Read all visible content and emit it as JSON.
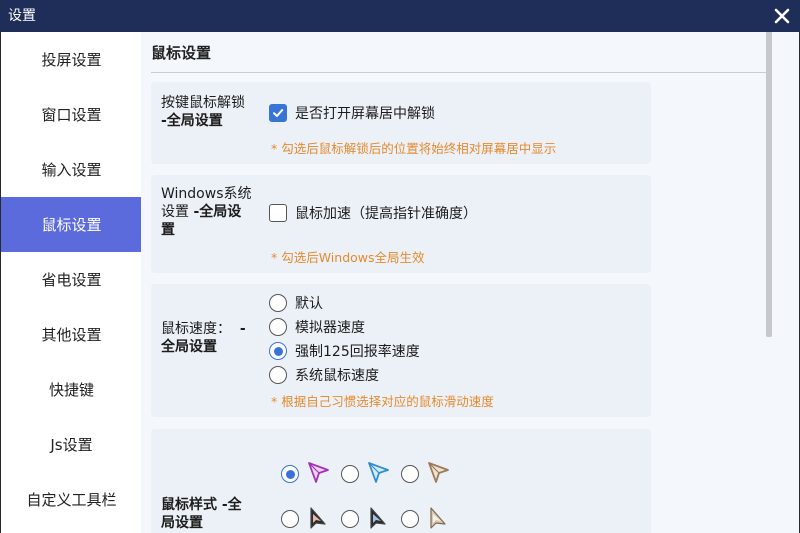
{
  "window": {
    "title": "设置"
  },
  "sidebar": {
    "items": [
      {
        "label": "投屏设置",
        "active": false
      },
      {
        "label": "窗口设置",
        "active": false
      },
      {
        "label": "输入设置",
        "active": false
      },
      {
        "label": "鼠标设置",
        "active": true
      },
      {
        "label": "省电设置",
        "active": false
      },
      {
        "label": "其他设置",
        "active": false
      },
      {
        "label": "快捷键",
        "active": false
      },
      {
        "label": "Js设置",
        "active": false
      },
      {
        "label": "自定义工具栏",
        "active": false
      }
    ]
  },
  "main": {
    "title": "鼠标设置",
    "unlock": {
      "label": "按键鼠标解锁",
      "scope": "-全局设置",
      "checkbox_label": "是否打开屏幕居中解锁",
      "checked": true,
      "note": "* 勾选后鼠标解锁后的位置将始终相对屏幕居中显示"
    },
    "windows": {
      "label": "Windows系统设置",
      "label_line1": "Windows系统",
      "label_line2a": "设置 ",
      "scope_line2": "-全局设",
      "scope_line3": "置",
      "checkbox_label": "鼠标加速（提高指针准确度）",
      "checked": false,
      "note": "* 勾选后Windows全局生效"
    },
    "speed": {
      "label": "鼠标速度：",
      "scope_line1": "-",
      "scope_line2": "全局设置",
      "options": [
        "默认",
        "模拟器速度",
        "强制125回报率速度",
        "系统鼠标速度"
      ],
      "selected": 2,
      "note": "* 根据自己习惯选择对应的鼠标滑动速度"
    },
    "style": {
      "label": "鼠标样式",
      "scope_line1": " -全",
      "scope_line2": "局设置",
      "options": [
        {
          "icon": "arrow-cursor-purple-icon"
        },
        {
          "icon": "arrow-cursor-blue-icon"
        },
        {
          "icon": "arrow-cursor-tan-icon"
        },
        {
          "icon": "pointer-cursor-dark-red-icon"
        },
        {
          "icon": "pointer-cursor-dark-blue-icon"
        },
        {
          "icon": "pointer-cursor-beige-icon"
        }
      ],
      "selected": 0
    }
  },
  "colors": {
    "titlebar": "#1f2e59",
    "accent": "#5b6bdc",
    "checkbox": "#3874d8",
    "note": "#e58a2e",
    "card": "#ecf1f8",
    "content_bg": "#f4f8fd"
  }
}
